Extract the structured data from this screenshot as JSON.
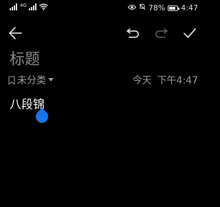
{
  "status_bar": {
    "network_label": "4G",
    "battery": "78%",
    "time": "4:47",
    "battery_level": 0.78
  },
  "toolbar": {
    "back_icon": "arrow-left-icon",
    "undo_icon": "undo-icon",
    "redo_icon": "redo-icon",
    "done_icon": "checkmark-icon"
  },
  "note": {
    "title_placeholder": "标题",
    "category": "未分类",
    "date": "今天",
    "time": "下午4:47",
    "body": "八段锦"
  },
  "colors": {
    "background": "#000000",
    "text": "#ffffff",
    "muted": "#9a9a9a",
    "accent": "#1a73e8"
  }
}
